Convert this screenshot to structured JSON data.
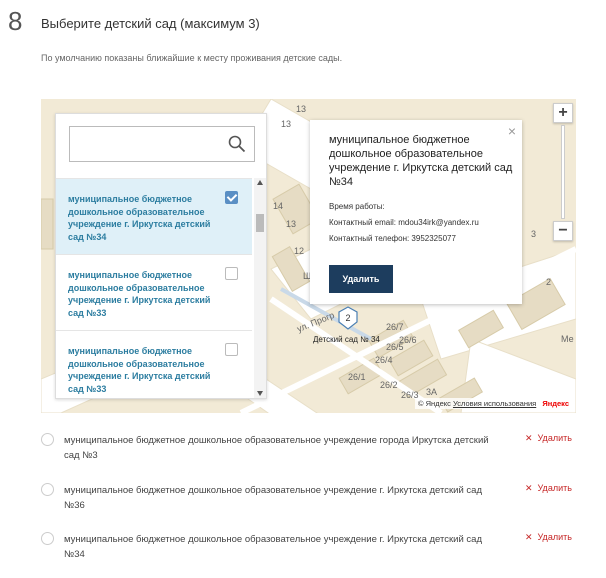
{
  "step": {
    "number": "8",
    "title": "Выберите детский сад (максимум 3)"
  },
  "hint": "По умолчанию показаны ближайшие к месту проживания детские сады.",
  "search": {
    "placeholder": "",
    "value": ""
  },
  "results": [
    {
      "label": "муниципальное бюджетное дошкольное образовательное учреждение г. Иркутска детский сад №34",
      "checked": true
    },
    {
      "label": "муниципальное бюджетное дошкольное образовательное учреждение г. Иркутска детский сад №33",
      "checked": false
    },
    {
      "label": "муниципальное бюджетное дошкольное образовательное учреждение г. Иркутска детский сад №33",
      "checked": false
    }
  ],
  "balloon": {
    "title": "муниципальное бюджетное дошкольное образовательное учреждение г. Иркутска детский сад №34",
    "hours": "Время работы:",
    "email": "Контактный email: mdou34irk@yandex.ru",
    "phone": "Контактный телефон: 3952325077",
    "delete_label": "Удалить",
    "close": "×"
  },
  "map": {
    "zoom_in": "+",
    "zoom_out": "−",
    "marker_number": "2",
    "marker_label": "Детский сад № 34",
    "copyright": "© Яндекс",
    "terms": "Условия использования",
    "brand": "Яндекс",
    "labels": [
      "13",
      "14",
      "12",
      "13",
      "3",
      "2",
      "13",
      "26/7",
      "26/6",
      "26/5",
      "26/4",
      "26/1",
      "26/2",
      "26/3",
      "3А",
      "ул. Прогр",
      "Ш",
      "Ме"
    ]
  },
  "selected": [
    {
      "text": "муниципальное бюджетное дошкольное образовательное учреждение города Иркутска детский сад №3",
      "remove": "Удалить"
    },
    {
      "text": "муниципальное бюджетное дошкольное образовательное учреждение г. Иркутска детский сад №36",
      "remove": "Удалить"
    },
    {
      "text": "муниципальное бюджетное дошкольное образовательное учреждение г. Иркутска детский сад №34",
      "remove": "Удалить"
    }
  ],
  "colors": {
    "accent": "#2c7da0",
    "button": "#1d3d5e",
    "remove": "#c62828",
    "selected_bg": "#dff0f8"
  }
}
